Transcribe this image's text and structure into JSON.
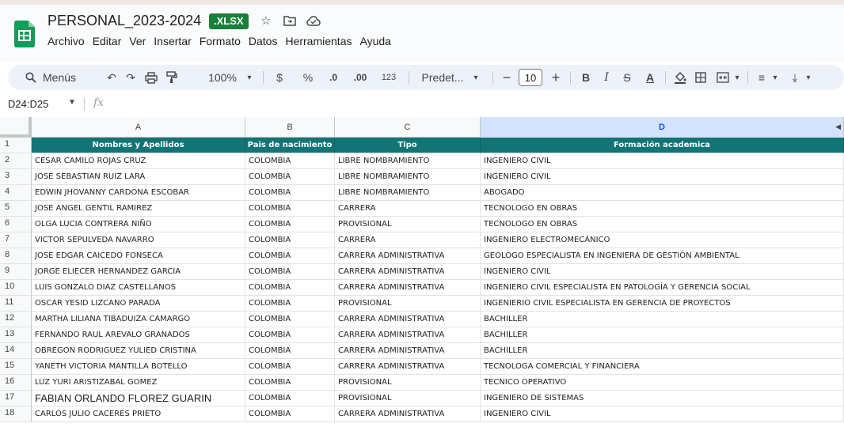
{
  "app": {
    "title": "PERSONAL_2023-2024",
    "file_badge": ".XLSX",
    "menu": [
      "Archivo",
      "Editar",
      "Ver",
      "Insertar",
      "Formato",
      "Datos",
      "Herramientas",
      "Ayuda"
    ]
  },
  "toolbar": {
    "menus_label": "Menús",
    "zoom": "100%",
    "currency": "$",
    "percent": "%",
    "decrease_decimal": ".0",
    "increase_decimal": ".00",
    "number_format": "123",
    "font_name": "Predet...",
    "font_size": "10",
    "bold": "B",
    "italic": "I",
    "text_color": "A"
  },
  "formula_bar": {
    "name_box": "D24:D25",
    "fx": "fx"
  },
  "sheet": {
    "columns": [
      "A",
      "B",
      "C",
      "D"
    ],
    "header": [
      "Nombres y Apellidos",
      "Pais de nacimiento",
      "Tipo",
      "Formación academica"
    ],
    "rows": [
      [
        "CESAR CAMILO ROJAS CRUZ",
        "COLOMBIA",
        "LIBRE NOMBRAMIENTO",
        "INGENIERO CIVIL"
      ],
      [
        "JOSE SEBASTIAN RUIZ LARA",
        "COLOMBIA",
        "LIBRE NOMBRAMIENTO",
        "INGENIERO CIVIL"
      ],
      [
        "EDWIN JHOVANNY CARDONA ESCOBAR",
        "COLOMBIA",
        "LIBRE NOMBRAMIENTO",
        "ABOGADO"
      ],
      [
        "JOSE ANGEL GENTIL RAMIREZ",
        "COLOMBIA",
        "CARRERA",
        "TECNOLOGO EN OBRAS"
      ],
      [
        "OLGA LUCIA CONTRERA NIÑO",
        "COLOMBIA",
        "PROVISIONAL",
        "TECNOLOGO EN OBRAS"
      ],
      [
        "VICTOR SEPULVEDA NAVARRO",
        "COLOMBIA",
        "CARRERA",
        "INGENIERO ELECTROMECÁNICO"
      ],
      [
        "JOSE EDGAR CAICEDO FONSECA",
        "COLOMBIA",
        "CARRERA ADMINISTRATIVA",
        "GEOLOGO ESPECIALISTA EN INGENIERA DE GESTIÓN AMBIENTAL"
      ],
      [
        "JORGE ELIECER HERNANDEZ GARCIA",
        "COLOMBIA",
        "CARRERA ADMINISTRATIVA",
        "INGENIERO CIVIL"
      ],
      [
        "LUIS GONZALO DIAZ CASTELLANOS",
        "COLOMBIA",
        "CARRERA ADMINISTRATIVA",
        "INGENIERO CIVIL ESPECIALISTA EN PATOLOGÍA Y GERENCIA SOCIAL"
      ],
      [
        "OSCAR YESID LIZCANO PARADA",
        "COLOMBIA",
        "PROVISIONAL",
        "INGENIERIO CIVIL ESPECIALISTA EN GERENCIA DE PROYECTOS"
      ],
      [
        "MARTHA LILIANA TIBADUIZA CAMARGO",
        "COLOMBIA",
        "CARRERA ADMINISTRATIVA",
        "BACHILLER"
      ],
      [
        "FERNANDO RAUL AREVALO GRANADOS",
        "COLOMBIA",
        "CARRERA ADMINISTRATIVA",
        "BACHILLER"
      ],
      [
        "OBREGON RODRIGUEZ YULIED CRISTINA",
        "COLOMBIA",
        "CARRERA ADMINISTRATIVA",
        "BACHILLER"
      ],
      [
        "YANETH VICTORIA MANTILLA BOTELLO",
        "COLOMBIA",
        "CARRERA ADMINISTRATIVA",
        "TECNOLOGA COMERCIAL Y FINANCIERA"
      ],
      [
        "LUZ YURI ARISTIZABAL GOMEZ",
        "COLOMBIA",
        "PROVISIONAL",
        "TECNICO OPERATIVO"
      ],
      [
        "FABIAN ORLANDO FLOREZ GUARIN",
        "COLOMBIA",
        "PROVISIONAL",
        "INGENIERO DE SISTEMAS"
      ],
      [
        "CARLOS JULIO CACERES PRIETO",
        "COLOMBIA",
        "CARRERA ADMINISTRATIVA",
        "INGENIERO CIVIL"
      ]
    ],
    "row_numbers": [
      "1",
      "2",
      "3",
      "4",
      "5",
      "6",
      "7",
      "8",
      "9",
      "10",
      "11",
      "12",
      "13",
      "14",
      "15",
      "16",
      "17",
      "18"
    ]
  },
  "colors": {
    "header_fill": "#127474",
    "xlsx_badge": "#188038",
    "selected_column": "#d3e3fd"
  }
}
